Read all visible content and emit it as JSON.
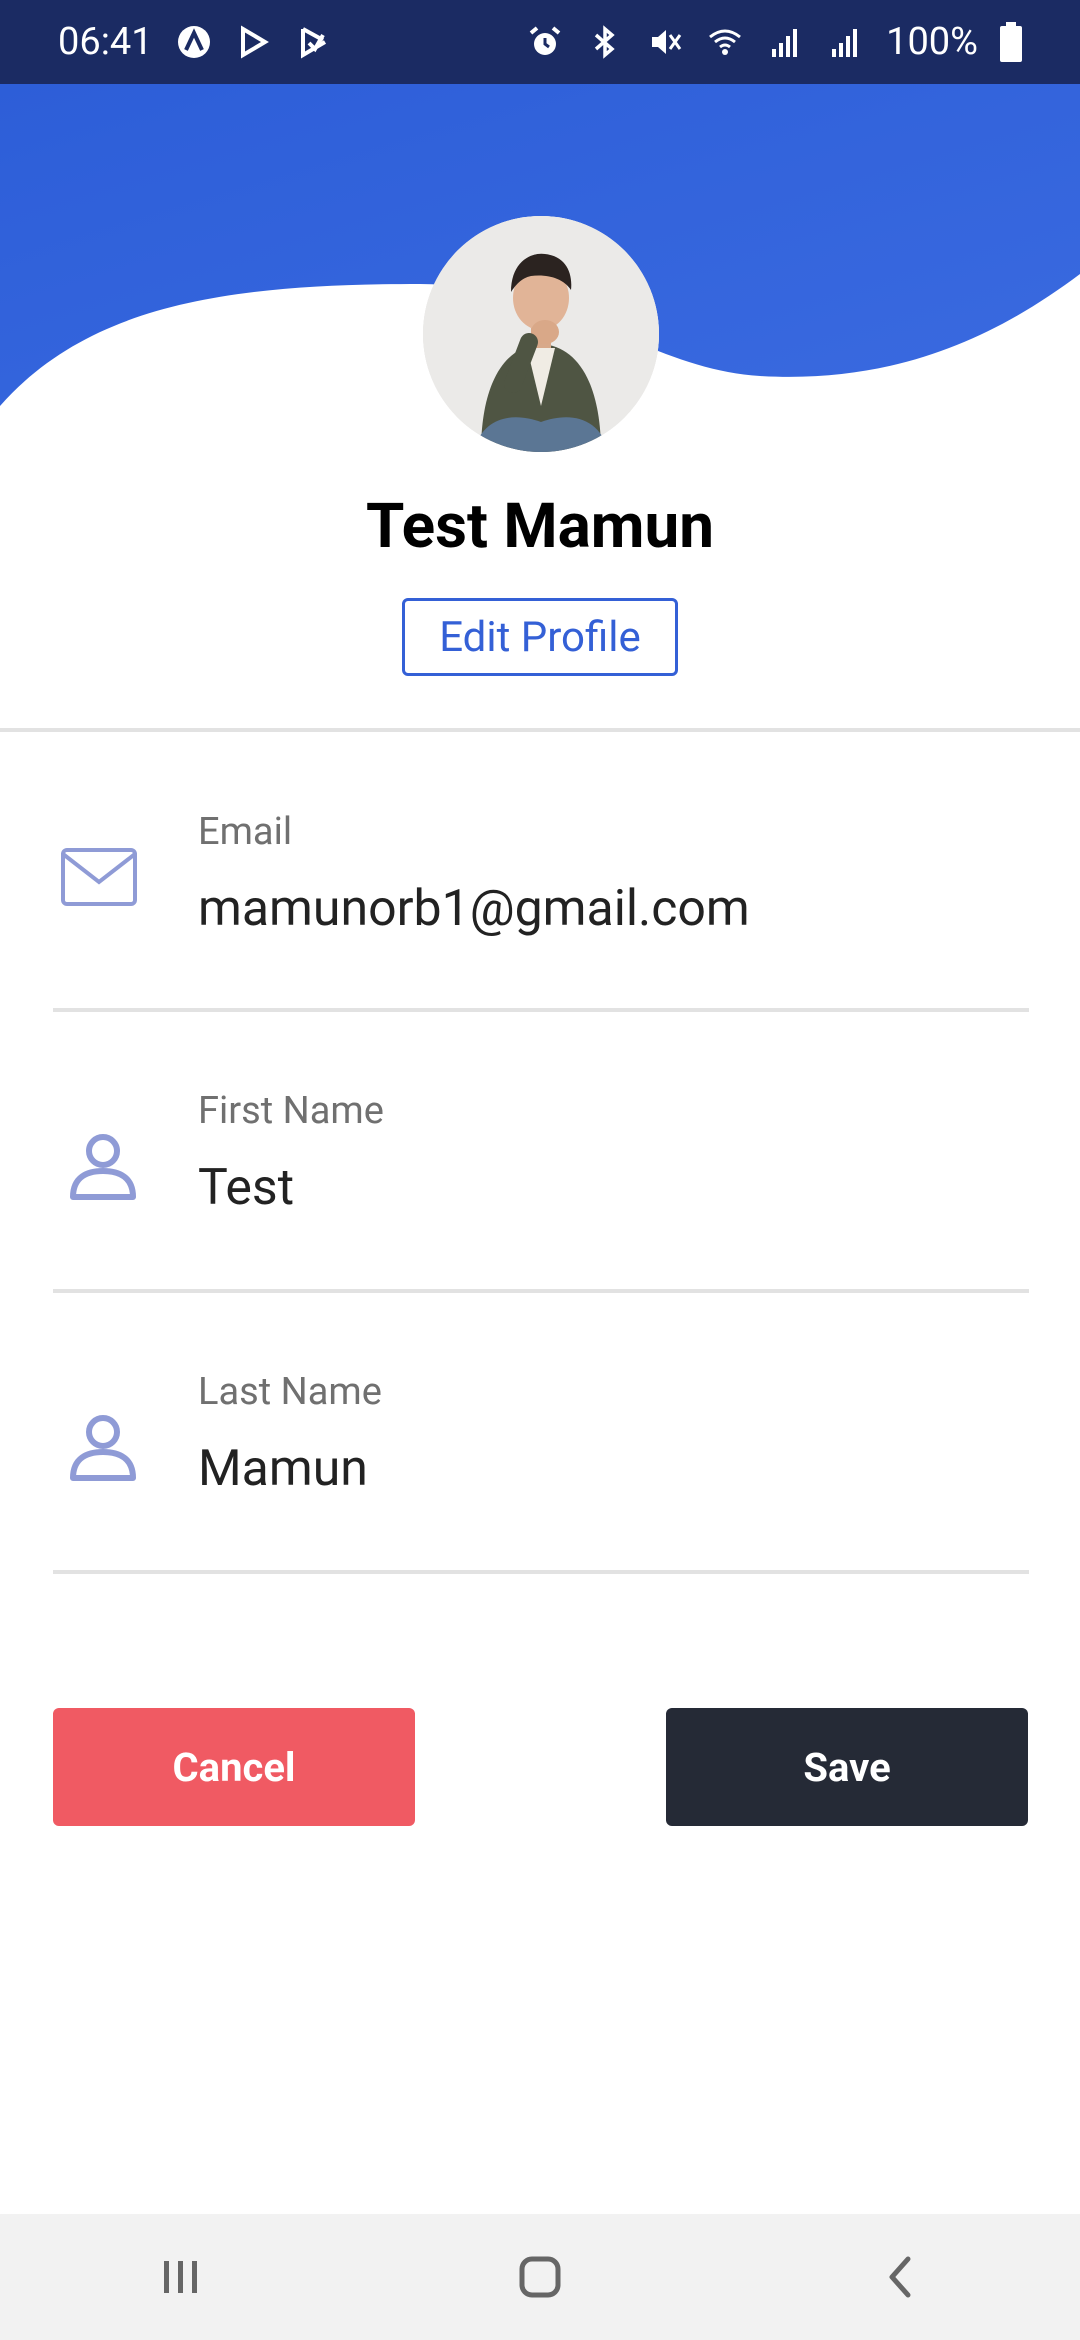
{
  "status_bar": {
    "time": "06:41",
    "battery": "100%"
  },
  "profile": {
    "name": "Test Mamun",
    "edit_label": "Edit Profile"
  },
  "fields": [
    {
      "label": "Email",
      "value": "mamunorb1@gmail.com",
      "icon": "mail-icon"
    },
    {
      "label": "First Name",
      "value": "Test",
      "icon": "person-icon"
    },
    {
      "label": "Last Name",
      "value": "Mamun",
      "icon": "person-icon"
    }
  ],
  "actions": {
    "cancel_label": "Cancel",
    "save_label": "Save"
  },
  "colors": {
    "header_blue": "#3460d6",
    "status_bar": "#1b2b63",
    "cancel_red": "#f05a63",
    "save_dark": "#252a36",
    "icon_lavender": "#8f9bd6"
  }
}
